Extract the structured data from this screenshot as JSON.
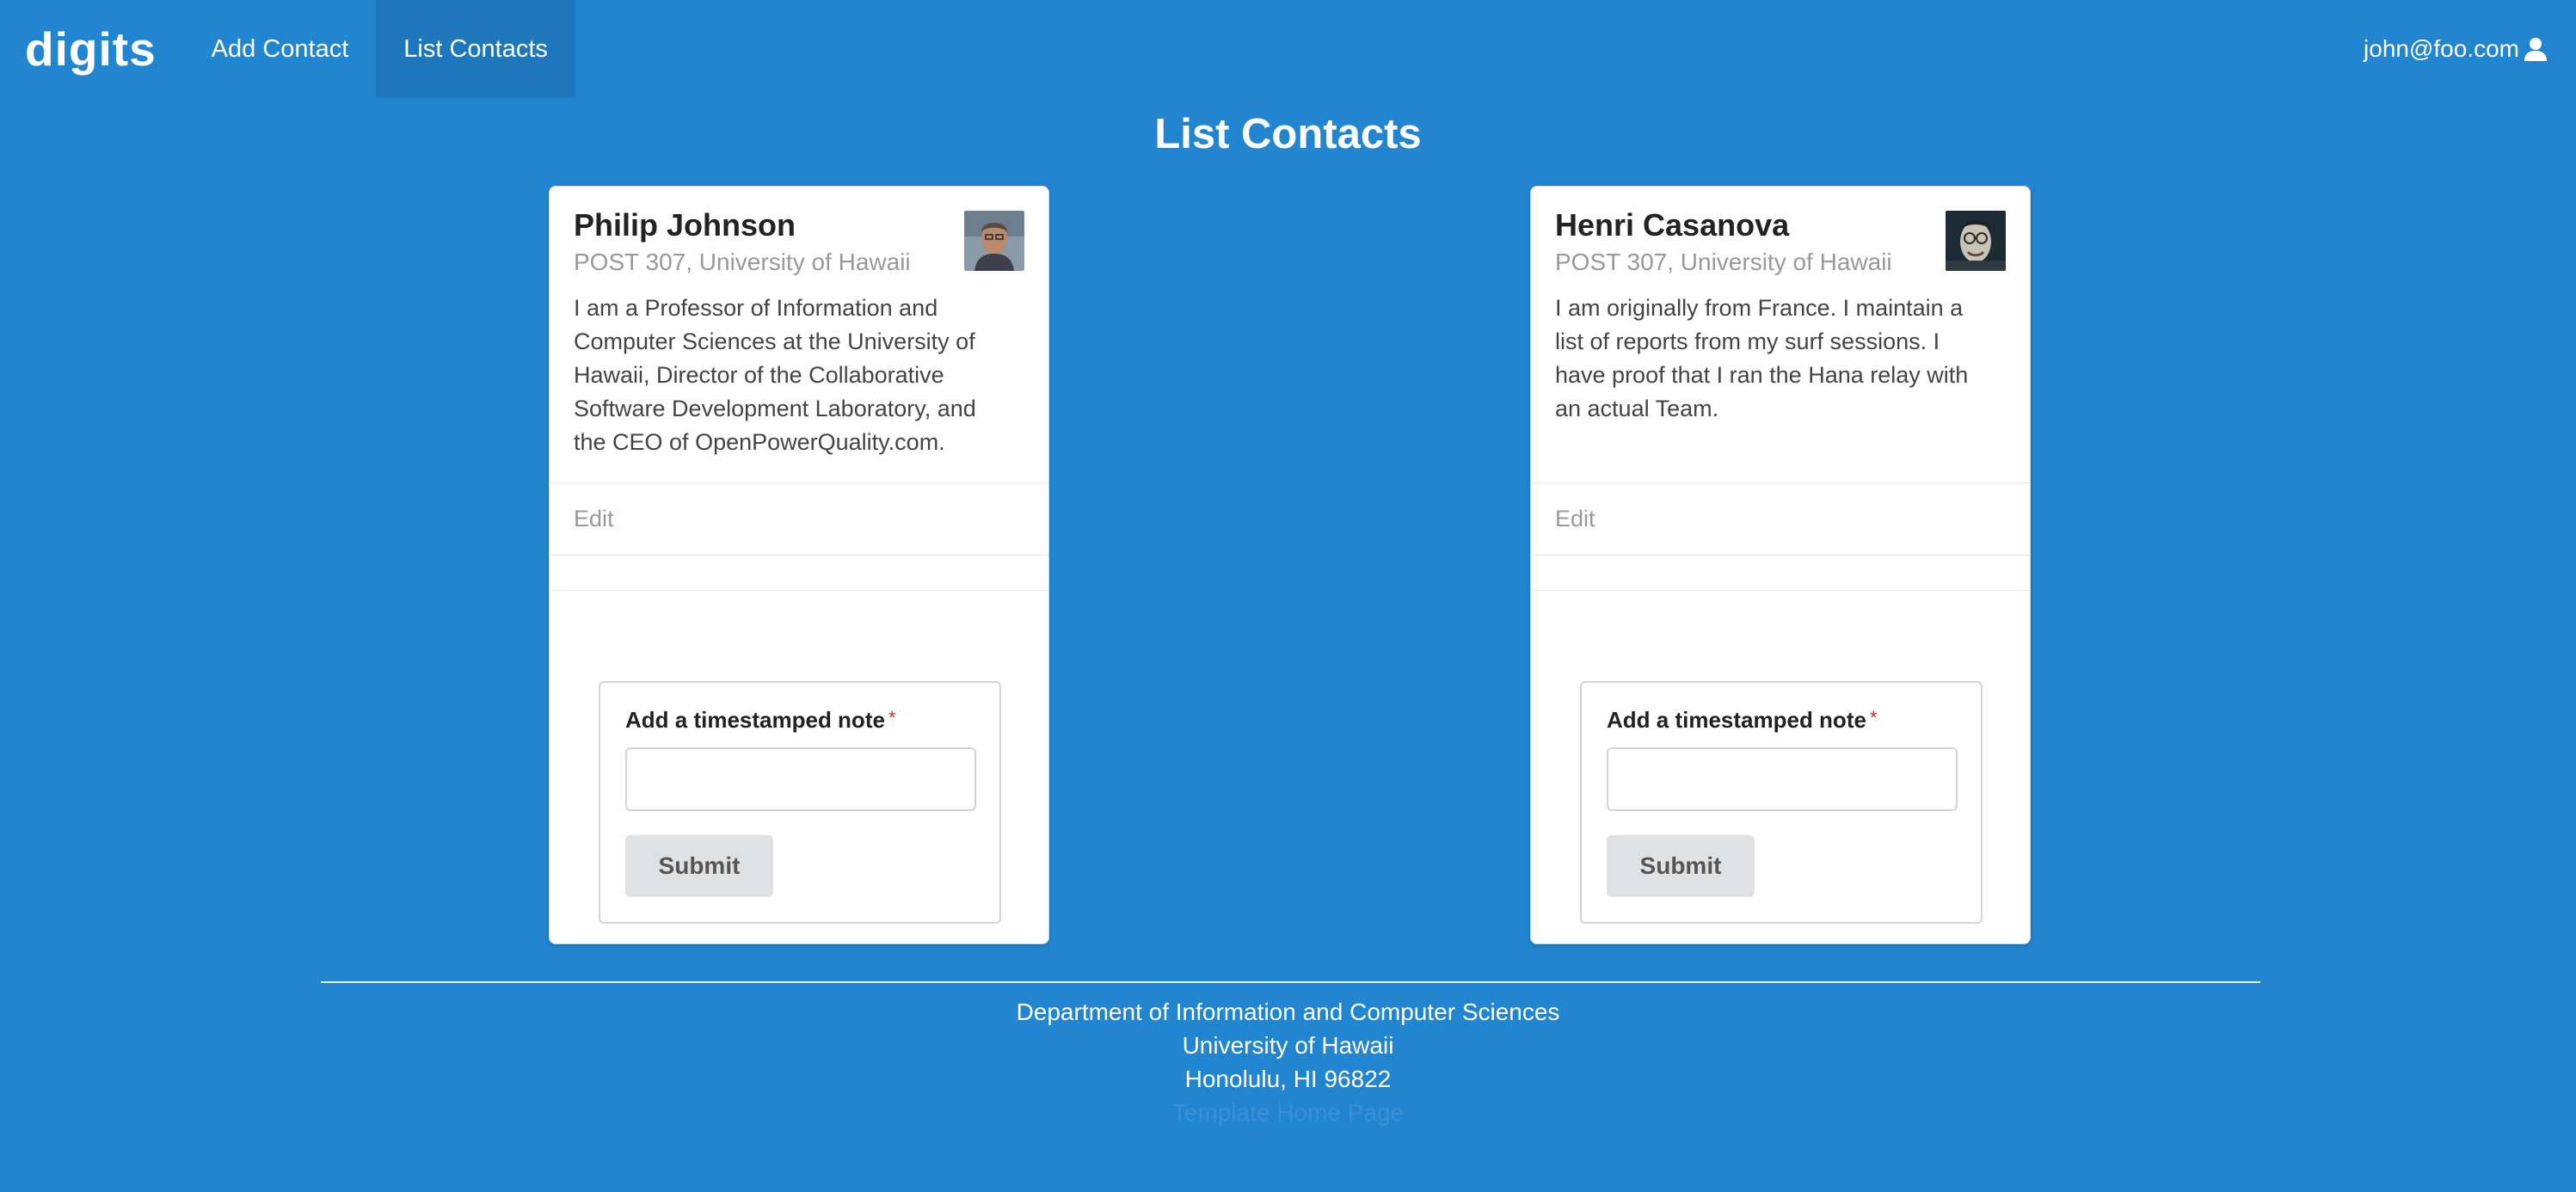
{
  "nav": {
    "brand": "digits",
    "items": [
      {
        "label": "Add Contact",
        "active": false
      },
      {
        "label": "List Contacts",
        "active": true
      }
    ],
    "user_email": "john@foo.com",
    "user_icon": "user-icon"
  },
  "page": {
    "title": "List Contacts"
  },
  "contacts": [
    {
      "name": "Philip Johnson",
      "address": "POST 307, University of Hawaii",
      "description": "I am a Professor of Information and Computer Sciences at the University of Hawaii, Director of the Collaborative Software Development Laboratory, and the CEO of OpenPowerQuality.com.",
      "edit_label": "Edit",
      "note_label": "Add a timestamped note",
      "note_value": "",
      "submit_label": "Submit"
    },
    {
      "name": "Henri Casanova",
      "address": "POST 307, University of Hawaii",
      "description": "I am originally from France. I maintain a list of reports from my surf sessions. I have proof that I ran the Hana relay with an actual Team.",
      "edit_label": "Edit",
      "note_label": "Add a timestamped note",
      "note_value": "",
      "submit_label": "Submit"
    }
  ],
  "footer": {
    "line1": "Department of Information and Computer Sciences",
    "line2": "University of Hawaii",
    "line3": "Honolulu, HI 96822",
    "link": "Template Home Page"
  },
  "colors": {
    "background": "#2185d0",
    "required_star": "#db2828",
    "button": "#e0e1e2"
  }
}
